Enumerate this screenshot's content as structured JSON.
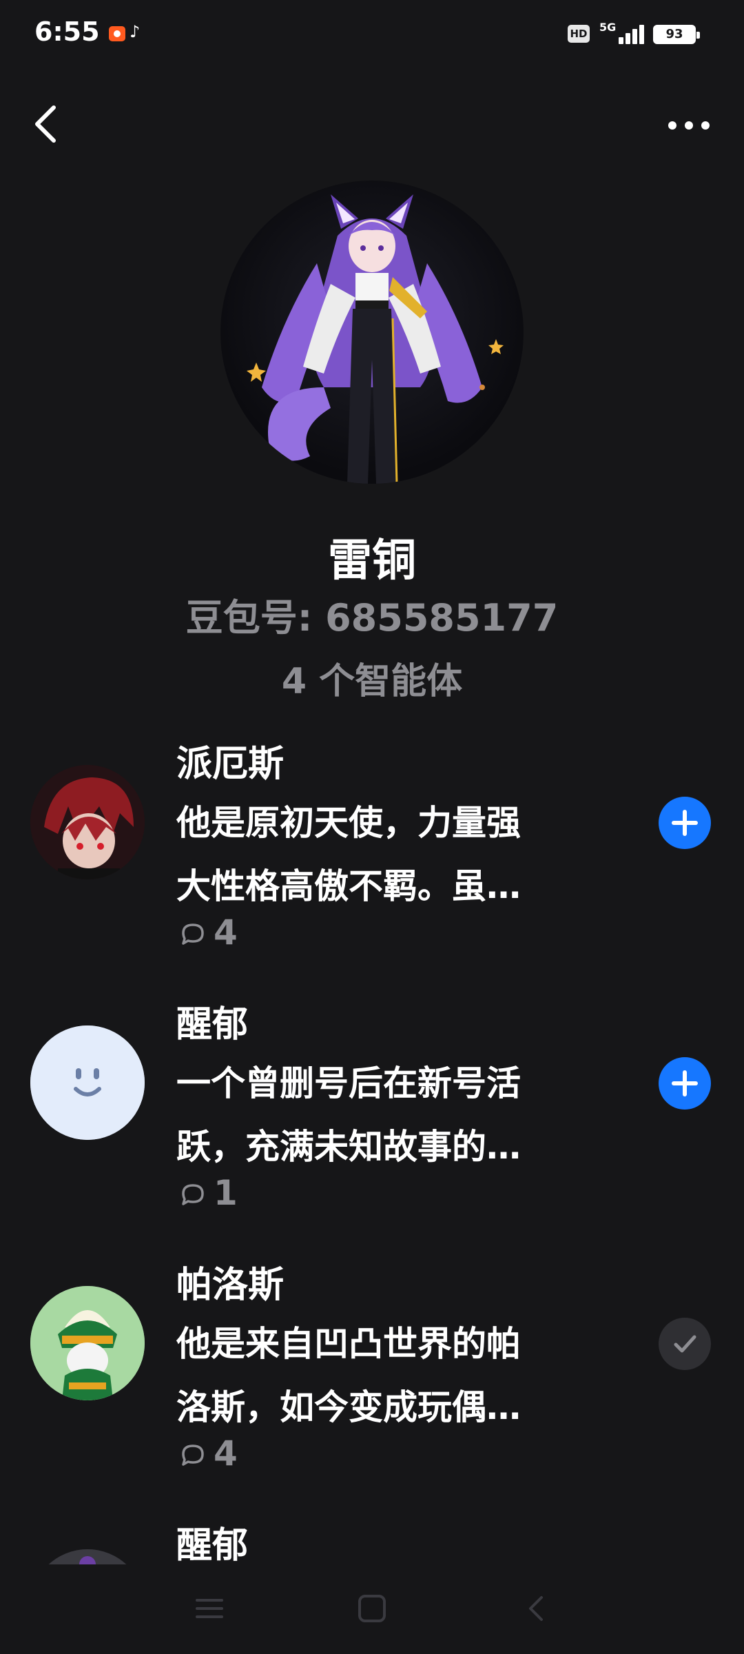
{
  "status_bar": {
    "time": "6:55",
    "hd_label": "HD",
    "network": "5G",
    "battery": "93",
    "battery_level_percent": 93,
    "notification_icons": [
      "screen-record-icon",
      "tiktok-icon"
    ]
  },
  "header": {
    "back_icon": "chevron-left-icon",
    "more_icon": "more-dots-icon"
  },
  "profile": {
    "name": "雷铜",
    "doubao_id": "豆包号: 685585177",
    "agent_count": "4 个智能体"
  },
  "agents": [
    {
      "name": "派厄斯",
      "desc_line1": "他是原初天使，力量强",
      "desc_line2": "大性格高傲不羁。虽…",
      "comments": "4",
      "action": "add",
      "action_icon": "plus-icon"
    },
    {
      "name": "醒郁",
      "desc_line1": "一个曾删号后在新号活",
      "desc_line2": "跃，充满未知故事的…",
      "comments": "1",
      "action": "add",
      "action_icon": "plus-icon"
    },
    {
      "name": "帕洛斯",
      "desc_line1": "他是来自凹凸世界的帕",
      "desc_line2": "洛斯，如今变成玩偶…",
      "comments": "4",
      "action": "added",
      "action_icon": "check-icon"
    },
    {
      "name": "醒郁",
      "desc_line1": "",
      "desc_line2": "",
      "comments": "",
      "action": "",
      "action_icon": ""
    }
  ],
  "nav_bar": {
    "icons": [
      "menu-icon",
      "home-square-icon",
      "back-triangle-icon"
    ]
  },
  "colors": {
    "background": "#161618",
    "accent_blue": "#1677ff",
    "secondary_text": "#8e8e93",
    "added_button": "#2f2f33"
  }
}
